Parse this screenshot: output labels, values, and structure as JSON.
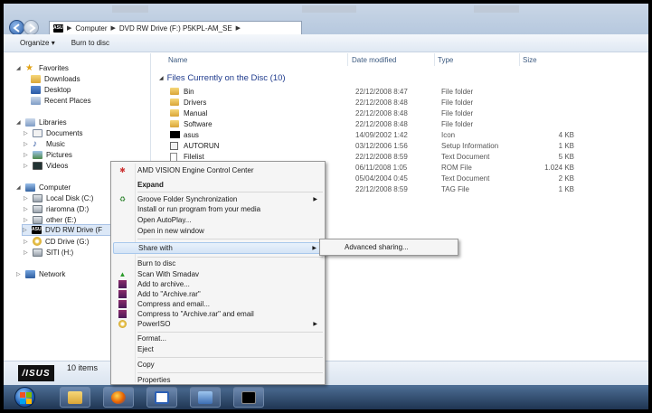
{
  "address": {
    "crumbs": [
      "Computer",
      "DVD RW Drive (F:) P5KPL-AM_SE"
    ]
  },
  "toolbar": {
    "organize_label": "Organize",
    "burn_label": "Burn to disc"
  },
  "nav": {
    "favorites": "Favorites",
    "downloads": "Downloads",
    "desktop": "Desktop",
    "recent": "Recent Places",
    "libraries": "Libraries",
    "documents": "Documents",
    "music": "Music",
    "pictures": "Pictures",
    "videos": "Videos",
    "computer": "Computer",
    "local_disk": "Local Disk (C:)",
    "riaromna": "riaromna (D:)",
    "other": "other (E:)",
    "dvd": "DVD RW Drive (F",
    "cd": "CD Drive (G:)",
    "siti": "SITI (H:)",
    "network": "Network"
  },
  "columns": {
    "name": "Name",
    "date": "Date modified",
    "type": "Type",
    "size": "Size"
  },
  "group_label": "Files Currently on the Disc (10)",
  "files": [
    {
      "name": "Bin",
      "date": "22/12/2008 8:47",
      "type": "File folder",
      "size": "",
      "icon": "folder-icon"
    },
    {
      "name": "Drivers",
      "date": "22/12/2008 8:48",
      "type": "File folder",
      "size": "",
      "icon": "folder-icon"
    },
    {
      "name": "Manual",
      "date": "22/12/2008 8:48",
      "type": "File folder",
      "size": "",
      "icon": "folder-icon"
    },
    {
      "name": "Software",
      "date": "22/12/2008 8:48",
      "type": "File folder",
      "size": "",
      "icon": "folder-icon"
    },
    {
      "name": "asus",
      "date": "14/09/2002 1:42",
      "type": "Icon",
      "size": "4 KB",
      "icon": "asus-icon"
    },
    {
      "name": "AUTORUN",
      "date": "03/12/2006 1:56",
      "type": "Setup Information",
      "size": "1 KB",
      "icon": "setup-icon"
    },
    {
      "name": "Filelist",
      "date": "22/12/2008 8:59",
      "type": "Text Document",
      "size": "5 KB",
      "icon": "text-icon"
    },
    {
      "name": "",
      "date": "06/11/2008 1:05",
      "type": "ROM File",
      "size": "1.024 KB",
      "icon": ""
    },
    {
      "name": "",
      "date": "05/04/2004 0:45",
      "type": "Text Document",
      "size": "2 KB",
      "icon": ""
    },
    {
      "name": "",
      "date": "22/12/2008 8:59",
      "type": "TAG File",
      "size": "1 KB",
      "icon": ""
    }
  ],
  "status": {
    "count": "10 items",
    "logo": "/ISUS"
  },
  "context_menu": {
    "amd": "AMD VISION Engine Control Center",
    "expand": "Expand",
    "groove": "Groove Folder Synchronization",
    "install": "Install or run program from your media",
    "autoplay": "Open AutoPlay...",
    "new_window": "Open in new window",
    "share": "Share with",
    "burn": "Burn to disc",
    "smadav": "Scan With Smadav",
    "add_archive": "Add to archive...",
    "add_rar": "Add to \"Archive.rar\"",
    "compress_email": "Compress and email...",
    "compress_rar_email": "Compress to \"Archive.rar\" and email",
    "poweriso": "PowerISO",
    "format": "Format...",
    "eject": "Eject",
    "copy": "Copy",
    "properties": "Properties"
  },
  "submenu": {
    "advanced_sharing": "Advanced sharing..."
  },
  "colors": {
    "accent": "#1e3a8c",
    "taskbar": "#2a4466",
    "highlight": "#d4e4f6"
  }
}
